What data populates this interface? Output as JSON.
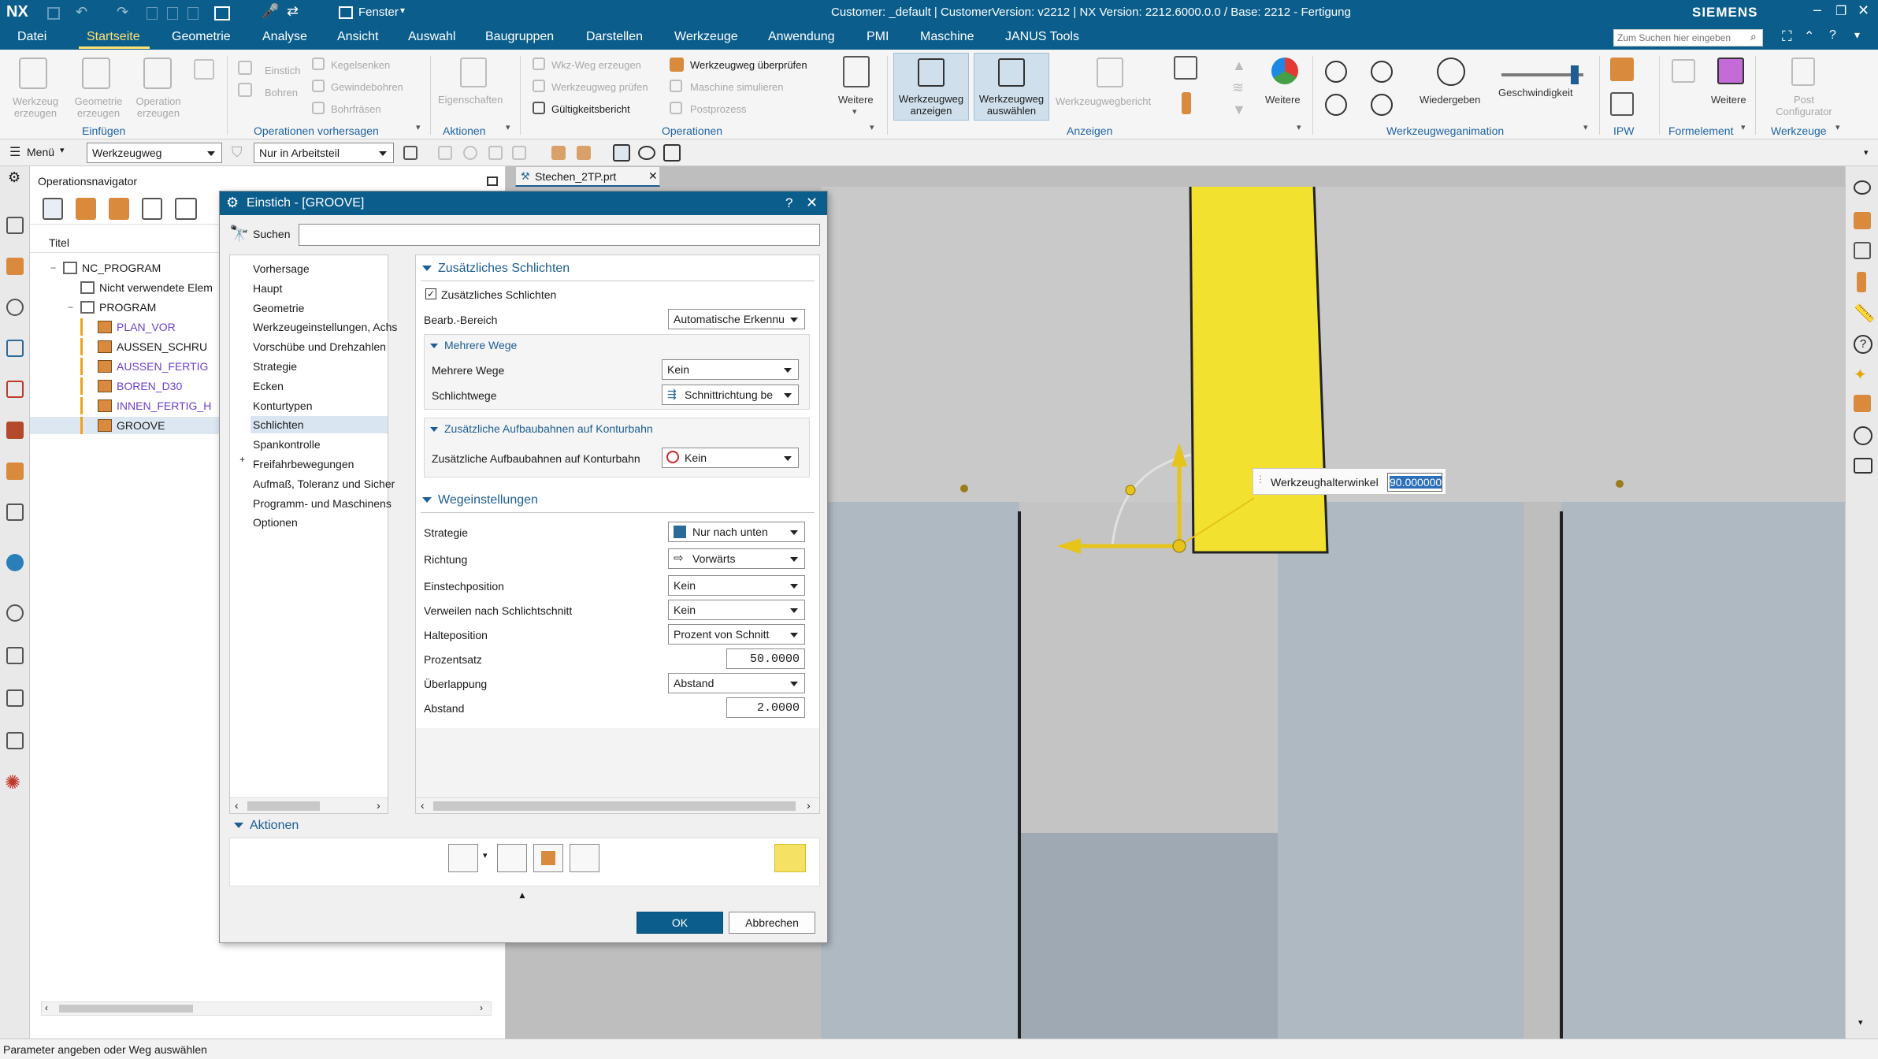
{
  "titlebar": {
    "app": "NX",
    "window_menu": "Fenster",
    "info": "Customer: _default | CustomerVersion: v2212 | NX Version: 2212.6000.0.0 / Base: 2212 - Fertigung",
    "brand": "SIEMENS"
  },
  "menu": {
    "items": [
      "Datei",
      "Startseite",
      "Geometrie",
      "Analyse",
      "Ansicht",
      "Auswahl",
      "Baugruppen",
      "Darstellen",
      "Werkzeuge",
      "Anwendung",
      "PMI",
      "Maschine",
      "JANUS Tools"
    ],
    "active": "Startseite",
    "search_placeholder": "Zum Suchen hier eingeben"
  },
  "ribbon": {
    "werkzeug_erzeugen": "Werkzeug erzeugen",
    "geometrie_erzeugen": "Geometrie erzeugen",
    "operation_erzeugen": "Operation erzeugen",
    "group_einfuegen": "Einfügen",
    "einstich": "Einstich",
    "bohren": "Bohren",
    "kegelsenken": "Kegelsenken",
    "gewindebohren": "Gewindebohren",
    "bohrfraesen": "Bohrfräsen",
    "group_op_vorhersagen": "Operationen vorhersagen",
    "eigenschaften": "Eigenschaften",
    "group_aktionen": "Aktionen",
    "wkz_weg_erzeugen": "Wkz-Weg erzeugen",
    "werkzeugweg_pruefen": "Werkzeugweg prüfen",
    "gueltigkeitsbericht": "Gültigkeitsbericht",
    "werkzeugweg_ueberpruefen": "Werkzeugweg überprüfen",
    "maschine_simulieren": "Maschine simulieren",
    "postprozess": "Postprozess",
    "group_operationen": "Operationen",
    "weitere1": "Weitere",
    "werkzeugweg_anzeigen": "Werkzeugweg anzeigen",
    "werkzeugweg_auswaehlen": "Werkzeugweg auswählen",
    "werkzeugwegbericht": "Werkzeugwegbericht",
    "weitere2": "Weitere",
    "group_anzeigen": "Anzeigen",
    "wiedergeben": "Wiedergeben",
    "geschwindigkeit": "Geschwindigkeit",
    "group_animation": "Werkzeugweganimation",
    "group_ipw": "IPW",
    "weitere3": "Weitere",
    "group_formelement": "Formelement",
    "post_configurator": "Post Configurator",
    "group_werkzeuge": "Werkzeuge"
  },
  "toolbar2": {
    "menu": "Menü",
    "filter": "Werkzeugweg",
    "scope": "Nur in Arbeitsteil"
  },
  "navigator": {
    "title": "Operationsnavigator",
    "column": "Titel",
    "tree": [
      {
        "label": "NC_PROGRAM",
        "level": 0,
        "color": "#1a1a1a"
      },
      {
        "label": "Nicht verwendete Elem",
        "level": 1,
        "color": "#1a1a1a"
      },
      {
        "label": "PROGRAM",
        "level": 1,
        "color": "#1a1a1a"
      },
      {
        "label": "PLAN_VOR",
        "level": 2,
        "color": "#6a3fc8"
      },
      {
        "label": "AUSSEN_SCHRU",
        "level": 2,
        "color": "#1a1a1a"
      },
      {
        "label": "AUSSEN_FERTIG",
        "level": 2,
        "color": "#6a3fc8"
      },
      {
        "label": "BOREN_D30",
        "level": 2,
        "color": "#6a3fc8"
      },
      {
        "label": "INNEN_FERTIG_H",
        "level": 2,
        "color": "#6a3fc8"
      },
      {
        "label": "GROOVE",
        "level": 2,
        "color": "#1a1a1a"
      }
    ]
  },
  "tab": {
    "label": "Stechen_2TP.prt"
  },
  "dialog": {
    "title": "Einstich - [GROOVE]",
    "search_label": "Suchen",
    "tree": [
      "Vorhersage",
      "Haupt",
      "Geometrie",
      "Werkzeugeinstellungen, Achs",
      "Vorschübe und Drehzahlen",
      "Strategie",
      "Ecken",
      "Konturtypen",
      "Schlichten",
      "Spankontrolle",
      "Freifahrbewegungen",
      "Aufmaß, Toleranz und Sicher",
      "Programm- und Maschinens",
      "Optionen"
    ],
    "tree_selected": "Schlichten",
    "sec1_title": "Zusätzliches Schlichten",
    "sec1_checkbox": "Zusätzliches Schlichten",
    "bearb_label": "Bearb.-Bereich",
    "bearb_value": "Automatische Erkennu",
    "mehrere_title": "Mehrere Wege",
    "mehrere_label": "Mehrere Wege",
    "mehrere_value": "Kein",
    "schlichtwege_label": "Schlichtwege",
    "schlichtwege_value": "Schnittrichtung be",
    "aufbau_title": "Zusätzliche Aufbaubahnen auf Konturbahn",
    "aufbau_label": "Zusätzliche Aufbaubahnen auf Konturbahn",
    "aufbau_value": "Kein",
    "sec2_title": "Wegeinstellungen",
    "strategie_label": "Strategie",
    "strategie_value": "Nur nach unten",
    "richtung_label": "Richtung",
    "richtung_value": "Vorwärts",
    "einstech_label": "Einstechposition",
    "einstech_value": "Kein",
    "verweilen_label": "Verweilen nach Schlichtschnitt",
    "verweilen_value": "Kein",
    "halte_label": "Halteposition",
    "halte_value": "Prozent von Schnitt",
    "prozent_label": "Prozentsatz",
    "prozent_value": "50.0000",
    "ueberlappung_label": "Überlappung",
    "ueberlappung_value": "Abstand",
    "abstand_label": "Abstand",
    "abstand_value": "2.0000",
    "aktionen_label": "Aktionen",
    "ok": "OK",
    "cancel": "Abbrechen"
  },
  "viewport": {
    "angle_label": "Werkzeughalterwinkel",
    "angle_value": "90.000000"
  },
  "status": "Parameter angeben oder Weg auswählen",
  "colors": {
    "accent": "#0b5e8c",
    "tool": "#f2e12e",
    "highlight": "#1d5d93"
  }
}
